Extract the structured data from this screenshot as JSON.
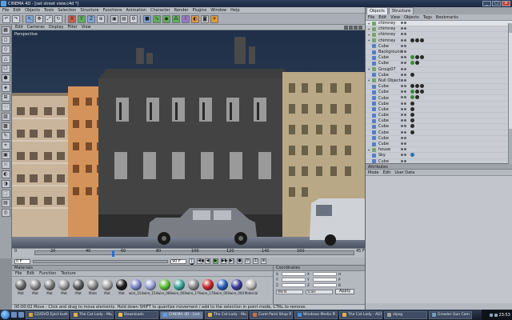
{
  "window": {
    "title": "CINEMA 4D - [set street view.c4d *]",
    "controls": [
      "_",
      "□",
      "×"
    ]
  },
  "menubar": [
    "File",
    "Edit",
    "Objects",
    "Tools",
    "Selection",
    "Structure",
    "Functions",
    "Animation",
    "Character",
    "Render",
    "Plugins",
    "Window",
    "Help"
  ],
  "toolbar": {
    "icons": [
      "undo-icon",
      "redo-icon",
      "live-select-icon",
      "move-icon",
      "scale-icon",
      "rotate-icon",
      "x-axis-icon",
      "y-axis-icon",
      "z-axis-icon",
      "world-coords-icon",
      "render-view-icon",
      "render-picture-icon",
      "render-settings-icon",
      "cube-icon",
      "spline-icon",
      "nurbs-icon",
      "array-icon",
      "deformer-icon",
      "scene-icon",
      "camera-icon",
      "light-icon"
    ],
    "glyphs": [
      "↶",
      "↷",
      "↖",
      "✥",
      "⤢",
      "↻",
      "X",
      "Y",
      "Z",
      "⊕",
      "▣",
      "▤",
      "⚙",
      "■",
      "∿",
      "◆",
      "⁂",
      "⌇",
      "◐",
      "◙",
      "☀"
    ]
  },
  "left_tools": [
    "▦",
    "◻",
    "◇",
    "△",
    "☐",
    "⬢",
    "◈",
    "⊞",
    "⋯",
    "▨",
    "▩",
    "✎",
    "⌖",
    "▣",
    "⤬",
    "◐",
    "◑",
    "⬚",
    "▤",
    "◎"
  ],
  "viewport": {
    "menu": [
      "Edit",
      "Cameras",
      "Display",
      "Filter",
      "View"
    ],
    "label": "Perspective"
  },
  "timeline": {
    "ticks": [
      "0",
      "10",
      "20",
      "30",
      "40",
      "50",
      "60",
      "70",
      "80",
      "90",
      "100",
      "110",
      "120",
      "130",
      "140",
      "150",
      "160",
      "170",
      "180"
    ],
    "frame_label": "45 F"
  },
  "transport": {
    "start": "0 F",
    "current": "90 F",
    "buttons": [
      "|◀",
      "◀◀",
      "◀",
      "▶",
      "▶▶",
      "▶|",
      "●",
      "⟳",
      "⚿",
      "⊕"
    ]
  },
  "materials": {
    "title": "Materials",
    "menu": [
      "File",
      "Edit",
      "Function",
      "Texture"
    ],
    "items": [
      {
        "name": "Mat",
        "color": "#6b6b6b"
      },
      {
        "name": "Mat",
        "color": "#8c8c8c"
      },
      {
        "name": "Mat",
        "color": "#7a7a7a"
      },
      {
        "name": "Mat",
        "color": "#9a9a9a"
      },
      {
        "name": "Mat",
        "color": "#5a5a5a"
      },
      {
        "name": "Mate",
        "color": "#8a8a8a"
      },
      {
        "name": "Mat",
        "color": "#a5a5a5"
      },
      {
        "name": "Mat",
        "color": "#1a1a1a"
      },
      {
        "name": "wire_154",
        "color": "#7a86c8"
      },
      {
        "name": "wire_154",
        "color": "#9aa4d8"
      },
      {
        "name": "wire_086",
        "color": "#5fbf3a"
      },
      {
        "name": "wire_000",
        "color": "#3aa79a"
      },
      {
        "name": "wire_176",
        "color": "#8a8a8a"
      },
      {
        "name": "wire_176",
        "color": "#c8282a"
      },
      {
        "name": "wire_000",
        "color": "#2a5fb8"
      },
      {
        "name": "wire_000",
        "color": "#3a3a9a"
      },
      {
        "name": "Material",
        "color": "#b8b8b8"
      }
    ]
  },
  "coordinates": {
    "title": "Coordinates",
    "rows": [
      [
        "X",
        "X",
        "H"
      ],
      [
        "Y",
        "Y",
        "P"
      ],
      [
        "Z",
        "Z",
        "B"
      ]
    ],
    "mode": "World",
    "scale": "Scale",
    "apply": "Apply"
  },
  "status": "00:00:02   Move : Click and drag to move elements. Hold down SHIFT to quantize movement / add to the selection in point mode, CTRL to remove.",
  "objects_panel": {
    "tabs": [
      "Objects",
      "Structure"
    ],
    "menu": [
      "File",
      "Edit",
      "View",
      "Objects",
      "Tags",
      "Bookmarks"
    ],
    "items": [
      {
        "name": "chimney",
        "icon": "#6fa86a",
        "expand": "+",
        "tags": []
      },
      {
        "name": "chimney",
        "icon": "#6fa86a",
        "expand": "+",
        "tags": []
      },
      {
        "name": "chimney",
        "icon": "#6fa86a",
        "expand": "+",
        "tags": []
      },
      {
        "name": "chimney",
        "icon": "#6fa86a",
        "expand": "+",
        "tags": [
          "#2a2a2a",
          "#2a2a2a",
          "#2a2a2a"
        ]
      },
      {
        "name": "Cube",
        "icon": "#4f7fd0",
        "expand": "",
        "tags": []
      },
      {
        "name": "Background",
        "icon": "#4f7fd0",
        "expand": "",
        "tags": []
      },
      {
        "name": "Cube",
        "icon": "#4f7fd0",
        "expand": "",
        "tags": [
          "#3a8a3a",
          "#2a2a2a",
          "#2a2a2a"
        ]
      },
      {
        "name": "Cube",
        "icon": "#4f7fd0",
        "expand": "",
        "tags": [
          "#3a8a3a",
          "#2a2a2a"
        ]
      },
      {
        "name": "Group07",
        "icon": "#6fa86a",
        "expand": "+",
        "tags": []
      },
      {
        "name": "Cube",
        "icon": "#4f7fd0",
        "expand": "",
        "tags": [
          "#2a2a2a"
        ]
      },
      {
        "name": "Null Object",
        "icon": "#6fa86a",
        "expand": "+",
        "tags": []
      },
      {
        "name": "Cube",
        "icon": "#4f7fd0",
        "expand": "",
        "tags": [
          "#2a2a2a",
          "#2a2a2a",
          "#2a2a2a"
        ]
      },
      {
        "name": "Cube",
        "icon": "#4f7fd0",
        "expand": "",
        "tags": [
          "#3a8a3a",
          "#2a2a2a",
          "#2a2a2a"
        ]
      },
      {
        "name": "Cube",
        "icon": "#4f7fd0",
        "expand": "",
        "tags": [
          "#3a8a3a",
          "#2a2a2a"
        ]
      },
      {
        "name": "Cube",
        "icon": "#4f7fd0",
        "expand": "",
        "tags": [
          "#2a2a2a"
        ]
      },
      {
        "name": "Cube",
        "icon": "#4f7fd0",
        "expand": "",
        "tags": [
          "#2a2a2a"
        ]
      },
      {
        "name": "Cube",
        "icon": "#4f7fd0",
        "expand": "",
        "tags": [
          "#2a2a2a"
        ]
      },
      {
        "name": "Cube",
        "icon": "#4f7fd0",
        "expand": "",
        "tags": [
          "#2a2a2a"
        ]
      },
      {
        "name": "Cube",
        "icon": "#4f7fd0",
        "expand": "",
        "tags": [
          "#2a2a2a"
        ]
      },
      {
        "name": "Cube",
        "icon": "#4f7fd0",
        "expand": "",
        "tags": [
          "#2a2a2a"
        ]
      },
      {
        "name": "Cube",
        "icon": "#4f7fd0",
        "expand": "",
        "tags": []
      },
      {
        "name": "Cube",
        "icon": "#4f7fd0",
        "expand": "",
        "tags": []
      },
      {
        "name": "house",
        "icon": "#6fa86a",
        "expand": "+",
        "tags": []
      },
      {
        "name": "Sky",
        "icon": "#4f7fd0",
        "expand": "",
        "tags": [
          "#2f6fb0"
        ]
      },
      {
        "name": "Cube",
        "icon": "#4f7fd0",
        "expand": "",
        "tags": []
      }
    ]
  },
  "attributes": {
    "title": "Attributes",
    "menu": [
      "Mode",
      "Edit",
      "User Data"
    ]
  },
  "taskbar": {
    "tasks": [
      {
        "label": "CD/DVD Eject butt...",
        "icon": "#d8a040"
      },
      {
        "label": "The Cat Lady - Mo...",
        "icon": "#e0b050"
      },
      {
        "label": "Downloads",
        "icon": "#e8c050"
      },
      {
        "label": "CINEMA 4D - [set ...",
        "icon": "#5ba0e0"
      },
      {
        "label": "The Cat Lady - Mo...",
        "icon": "#e0b050"
      },
      {
        "label": "Corel Paint Shop P...",
        "icon": "#c87040"
      },
      {
        "label": "Windows Media Pl...",
        "icon": "#4a90d8"
      },
      {
        "label": "The Cat Lady - AGS Edi...",
        "icon": "#e0b050"
      },
      {
        "label": "stpsg",
        "icon": "#a0a0a0"
      },
      {
        "label": "Growler Gun Cam",
        "icon": "#70a0c0"
      }
    ],
    "clock": "23:53"
  }
}
